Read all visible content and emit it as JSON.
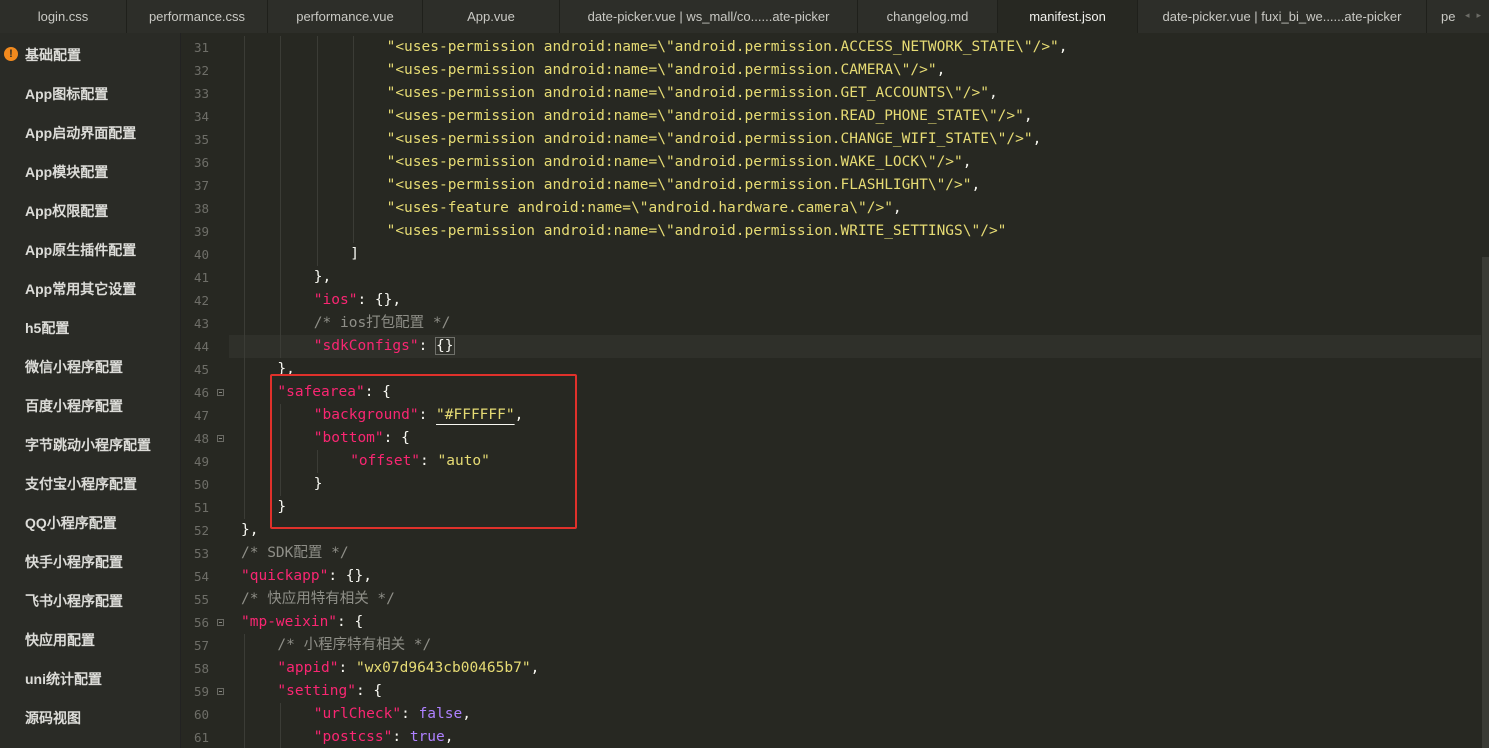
{
  "tabs": [
    {
      "label": "login.css"
    },
    {
      "label": "performance.css"
    },
    {
      "label": "performance.vue"
    },
    {
      "label": "App.vue"
    },
    {
      "label": "date-picker.vue | ws_mall/co......ate-picker"
    },
    {
      "label": "changelog.md"
    },
    {
      "label": "manifest.json",
      "active": true
    },
    {
      "label": "date-picker.vue | fuxi_bi_we......ate-picker"
    },
    {
      "label": "pe"
    }
  ],
  "tab_scroll": {
    "left": "◂",
    "right": "▸"
  },
  "sidebar": {
    "warn_glyph": "!",
    "items": [
      {
        "label": "基础配置"
      },
      {
        "label": "App图标配置"
      },
      {
        "label": "App启动界面配置"
      },
      {
        "label": "App模块配置"
      },
      {
        "label": "App权限配置"
      },
      {
        "label": "App原生插件配置"
      },
      {
        "label": "App常用其它设置"
      },
      {
        "label": "h5配置"
      },
      {
        "label": "微信小程序配置"
      },
      {
        "label": "百度小程序配置"
      },
      {
        "label": "字节跳动小程序配置"
      },
      {
        "label": "支付宝小程序配置"
      },
      {
        "label": "QQ小程序配置"
      },
      {
        "label": "快手小程序配置"
      },
      {
        "label": "飞书小程序配置"
      },
      {
        "label": "快应用配置"
      },
      {
        "label": "uni统计配置"
      },
      {
        "label": "源码视图"
      }
    ]
  },
  "editor": {
    "lines": [
      {
        "n": "31",
        "indent": 5,
        "t": [
          [
            "s",
            "\"<uses-permission android:name=\\\"android.permission.ACCESS_NETWORK_STATE\\\"/>\""
          ],
          [
            "p",
            ","
          ]
        ]
      },
      {
        "n": "32",
        "indent": 5,
        "t": [
          [
            "s",
            "\"<uses-permission android:name=\\\"android.permission.CAMERA\\\"/>\""
          ],
          [
            "p",
            ","
          ]
        ]
      },
      {
        "n": "33",
        "indent": 5,
        "t": [
          [
            "s",
            "\"<uses-permission android:name=\\\"android.permission.GET_ACCOUNTS\\\"/>\""
          ],
          [
            "p",
            ","
          ]
        ]
      },
      {
        "n": "34",
        "indent": 5,
        "t": [
          [
            "s",
            "\"<uses-permission android:name=\\\"android.permission.READ_PHONE_STATE\\\"/>\""
          ],
          [
            "p",
            ","
          ]
        ]
      },
      {
        "n": "35",
        "indent": 5,
        "t": [
          [
            "s",
            "\"<uses-permission android:name=\\\"android.permission.CHANGE_WIFI_STATE\\\"/>\""
          ],
          [
            "p",
            ","
          ]
        ]
      },
      {
        "n": "36",
        "indent": 5,
        "t": [
          [
            "s",
            "\"<uses-permission android:name=\\\"android.permission.WAKE_LOCK\\\"/>\""
          ],
          [
            "p",
            ","
          ]
        ]
      },
      {
        "n": "37",
        "indent": 5,
        "t": [
          [
            "s",
            "\"<uses-permission android:name=\\\"android.permission.FLASHLIGHT\\\"/>\""
          ],
          [
            "p",
            ","
          ]
        ]
      },
      {
        "n": "38",
        "indent": 5,
        "t": [
          [
            "s",
            "\"<uses-feature android:name=\\\"android.hardware.camera\\\"/>\""
          ],
          [
            "p",
            ","
          ]
        ]
      },
      {
        "n": "39",
        "indent": 5,
        "t": [
          [
            "s",
            "\"<uses-permission android:name=\\\"android.permission.WRITE_SETTINGS\\\"/>\""
          ]
        ]
      },
      {
        "n": "40",
        "indent": 4,
        "t": [
          [
            "p",
            "]"
          ]
        ]
      },
      {
        "n": "41",
        "indent": 3,
        "t": [
          [
            "p",
            "},"
          ]
        ]
      },
      {
        "n": "42",
        "indent": 3,
        "t": [
          [
            "k",
            "\"ios\""
          ],
          [
            "p",
            ": {},"
          ]
        ]
      },
      {
        "n": "43",
        "indent": 3,
        "t": [
          [
            "c",
            "/* ios打包配置 */"
          ]
        ]
      },
      {
        "n": "44",
        "indent": 3,
        "hl": true,
        "t": [
          [
            "k",
            "\"sdkConfigs\""
          ],
          [
            "p",
            ": "
          ],
          [
            "box",
            "{}"
          ]
        ]
      },
      {
        "n": "45",
        "indent": 2,
        "t": [
          [
            "p",
            "},"
          ]
        ]
      },
      {
        "n": "46",
        "indent": 2,
        "fold": true,
        "t": [
          [
            "k",
            "\"safearea\""
          ],
          [
            "p",
            ": {"
          ]
        ]
      },
      {
        "n": "47",
        "indent": 3,
        "t": [
          [
            "k",
            "\"background\""
          ],
          [
            "p",
            ": "
          ],
          [
            "hex",
            "\"#FFFFFF\""
          ],
          [
            "p",
            ","
          ]
        ]
      },
      {
        "n": "48",
        "indent": 3,
        "fold": true,
        "t": [
          [
            "k",
            "\"bottom\""
          ],
          [
            "p",
            ": {"
          ]
        ]
      },
      {
        "n": "49",
        "indent": 4,
        "t": [
          [
            "k",
            "\"offset\""
          ],
          [
            "p",
            ": "
          ],
          [
            "s",
            "\"auto\""
          ]
        ]
      },
      {
        "n": "50",
        "indent": 3,
        "t": [
          [
            "p",
            "}"
          ]
        ]
      },
      {
        "n": "51",
        "indent": 2,
        "t": [
          [
            "p",
            "}"
          ]
        ]
      },
      {
        "n": "52",
        "indent": 1,
        "t": [
          [
            "p",
            "},"
          ]
        ]
      },
      {
        "n": "53",
        "indent": 1,
        "t": [
          [
            "c",
            "/* SDK配置 */"
          ]
        ]
      },
      {
        "n": "54",
        "indent": 1,
        "t": [
          [
            "k",
            "\"quickapp\""
          ],
          [
            "p",
            ": {},"
          ]
        ]
      },
      {
        "n": "55",
        "indent": 1,
        "t": [
          [
            "c",
            "/* 快应用特有相关 */"
          ]
        ]
      },
      {
        "n": "56",
        "indent": 1,
        "fold": true,
        "t": [
          [
            "k",
            "\"mp-weixin\""
          ],
          [
            "p",
            ": {"
          ]
        ]
      },
      {
        "n": "57",
        "indent": 2,
        "t": [
          [
            "c",
            "/* 小程序特有相关 */"
          ]
        ]
      },
      {
        "n": "58",
        "indent": 2,
        "t": [
          [
            "k",
            "\"appid\""
          ],
          [
            "p",
            ": "
          ],
          [
            "s",
            "\"wx07d9643cb00465b7\""
          ],
          [
            "p",
            ","
          ]
        ]
      },
      {
        "n": "59",
        "indent": 2,
        "fold": true,
        "t": [
          [
            "k",
            "\"setting\""
          ],
          [
            "p",
            ": {"
          ]
        ]
      },
      {
        "n": "60",
        "indent": 3,
        "t": [
          [
            "k",
            "\"urlCheck\""
          ],
          [
            "p",
            ": "
          ],
          [
            "b",
            "false"
          ],
          [
            "p",
            ","
          ]
        ]
      },
      {
        "n": "61",
        "indent": 3,
        "t": [
          [
            "k",
            "\"postcss\""
          ],
          [
            "p",
            ": "
          ],
          [
            "b",
            "true"
          ],
          [
            "p",
            ","
          ]
        ]
      }
    ]
  },
  "colors": {
    "background": "#272822",
    "string": "#e6db74",
    "key": "#f92672",
    "boolean": "#ae81ff",
    "comment": "#8f8f88",
    "highlight_box": "#e0312b",
    "warning": "#f28a1e"
  }
}
